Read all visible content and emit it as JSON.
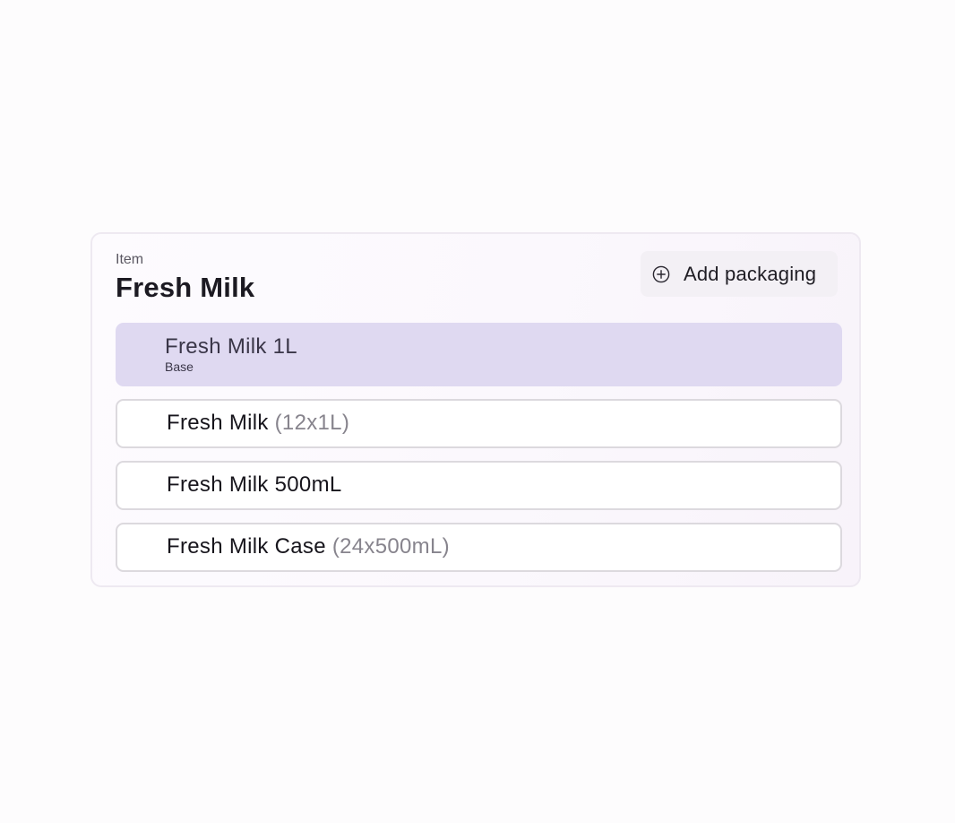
{
  "item": {
    "label": "Item",
    "title": "Fresh Milk"
  },
  "toolbar": {
    "add_packaging_label": "Add packaging",
    "add_icon": "plus-circle-icon"
  },
  "packagings": [
    {
      "name": "Fresh Milk 1L",
      "qty": "",
      "sub": "Base",
      "selected": true
    },
    {
      "name": "Fresh Milk",
      "qty": "(12x1L)",
      "sub": "",
      "selected": false
    },
    {
      "name": "Fresh Milk 500mL",
      "qty": "",
      "sub": "",
      "selected": false
    },
    {
      "name": "Fresh Milk Case",
      "qty": "(24x500mL)",
      "sub": "",
      "selected": false
    }
  ],
  "colors": {
    "selected_bg": "#dfd9f1",
    "border": "#dcd9de",
    "qty_text": "#87848d"
  }
}
